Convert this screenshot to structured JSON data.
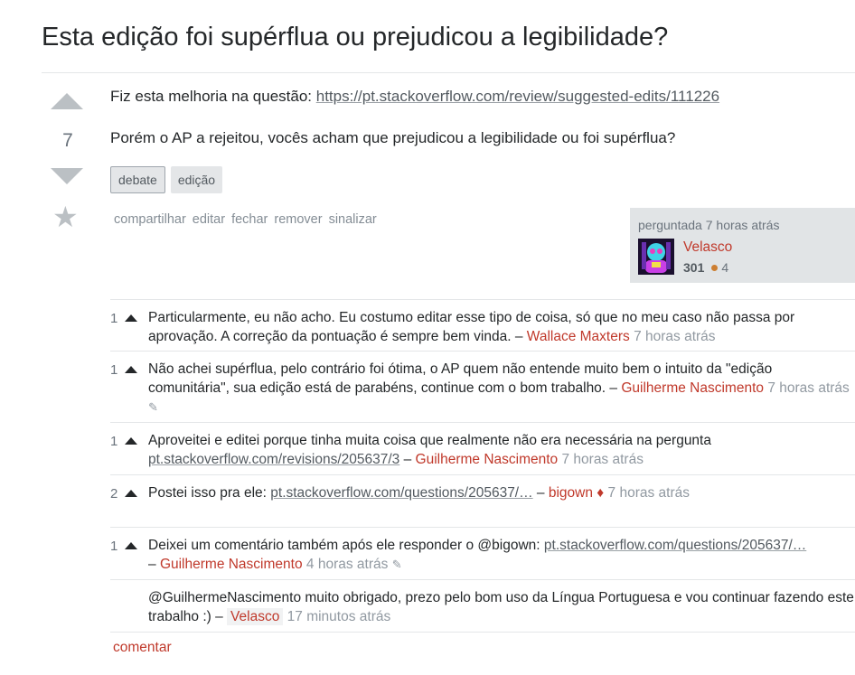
{
  "question": {
    "title": "Esta edição foi supérflua ou prejudicou a legibilidade?",
    "vote_count": "7",
    "body_line1_prefix": "Fiz esta melhoria na questão: ",
    "body_line1_link": "https://pt.stackoverflow.com/review/suggested-edits/111226",
    "body_line2": "Porém o AP a rejeitou, vocês acham que prejudicou a legibilidade ou foi supérflua?",
    "tags": [
      "debate",
      "edição"
    ],
    "menu": [
      "compartilhar",
      "editar",
      "fechar",
      "remover",
      "sinalizar"
    ],
    "asked_label": "perguntada 7 horas atrás",
    "user": {
      "name": "Velasco",
      "reputation": "301",
      "bronze": "4"
    }
  },
  "comments": [
    {
      "score": "1",
      "text": "Particularmente, eu não acho. Eu costumo editar esse tipo de coisa, só que no meu caso não passa por aprovação. A correção da pontuação é sempre bem vinda. – ",
      "user": "Wallace Maxters",
      "time": "7 horas atrás"
    },
    {
      "score": "1",
      "text": "Não achei supérflua, pelo contrário foi ótima, o AP quem não entende muito bem o intuito da \"edição comunitária\", sua edição está de parabéns, continue com o bom trabalho. – ",
      "user": "Guilherme Nascimento",
      "time": "7 horas atrás"
    },
    {
      "score": "1",
      "text": "Aproveitei e editei porque tinha muita coisa que realmente não era necessária na pergunta ",
      "link": "pt.stackoverflow.com/revisions/205637/3",
      "user": "Guilherme Nascimento",
      "time": "7 horas atrás"
    },
    {
      "score": "2",
      "text": "Postei isso pra ele: ",
      "link": "pt.stackoverflow.com/questions/205637/…",
      "user": "bigown",
      "time": "7 horas atrás"
    },
    {
      "score": "1",
      "text": "Deixei um comentário também após ele responder o @bigown: ",
      "link": "pt.stackoverflow.com/questions/205637/…",
      "user": "Guilherme Nascimento",
      "time": "4 horas atrás"
    },
    {
      "score": "",
      "text": "@GuilhermeNascimento muito obrigado, prezo pelo bom uso da Língua Portuguesa e vou continuar fazendo este trabalho :) – ",
      "user": "Velasco",
      "time": "17 minutos atrás"
    }
  ],
  "add_comment_label": "comentar",
  "colors": {
    "user_link": "#c0392b",
    "tag_bg": "#e4e6e8",
    "card_bg": "#e1e4e6"
  },
  "icons": [
    "upvote-icon",
    "downvote-icon",
    "favorite-star-icon",
    "comment-upvote-icon",
    "pencil-icon",
    "moderator-diamond-icon"
  ]
}
